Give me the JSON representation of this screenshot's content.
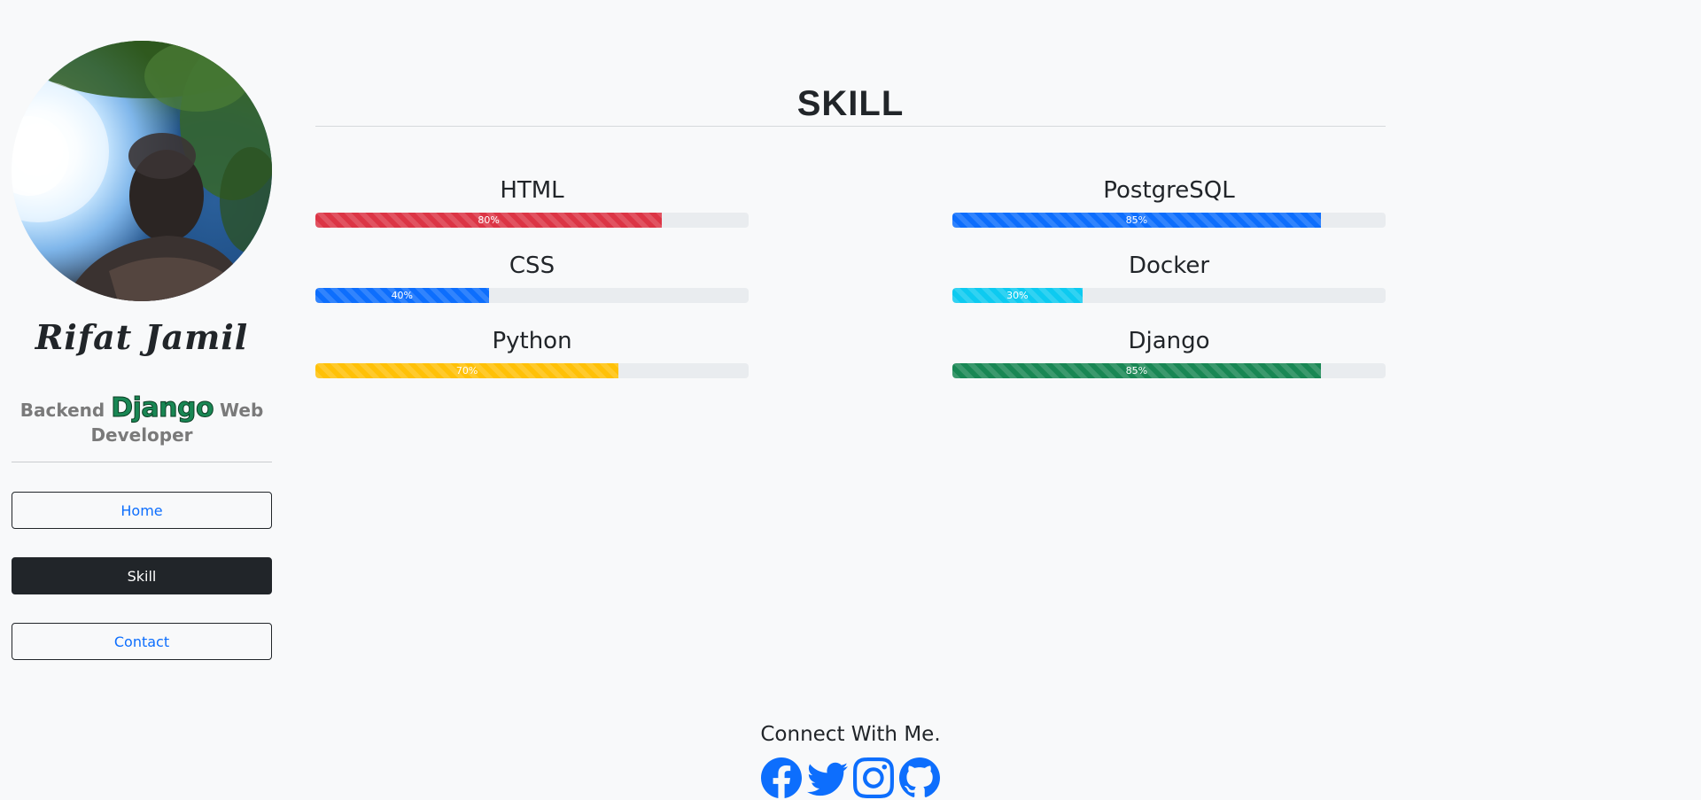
{
  "sidebar": {
    "name": "Rifat Jamil",
    "tagline": {
      "prefix": "Backend",
      "brand": "Django",
      "suffix": "Web Developer"
    },
    "nav": [
      {
        "label": "Home",
        "active": false
      },
      {
        "label": "Skill",
        "active": true
      },
      {
        "label": "Contact",
        "active": false
      }
    ]
  },
  "main": {
    "title": "SKILL",
    "skills": [
      {
        "name": "HTML",
        "percent": 80,
        "label": "80%",
        "color": "#dc3545"
      },
      {
        "name": "PostgreSQL",
        "percent": 85,
        "label": "85%",
        "color": "#0d6efd"
      },
      {
        "name": "CSS",
        "percent": 40,
        "label": "40%",
        "color": "#0d6efd"
      },
      {
        "name": "Docker",
        "percent": 30,
        "label": "30%",
        "color": "#0dcaf0"
      },
      {
        "name": "Python",
        "percent": 70,
        "label": "70%",
        "color": "#ffc107"
      },
      {
        "name": "Django",
        "percent": 85,
        "label": "85%",
        "color": "#198754"
      }
    ]
  },
  "footer": {
    "heading": "Connect With Me.",
    "socials": [
      {
        "name": "facebook-icon"
      },
      {
        "name": "twitter-icon"
      },
      {
        "name": "instagram-icon"
      },
      {
        "name": "github-icon"
      }
    ],
    "icon_color": "#0d6efd"
  }
}
